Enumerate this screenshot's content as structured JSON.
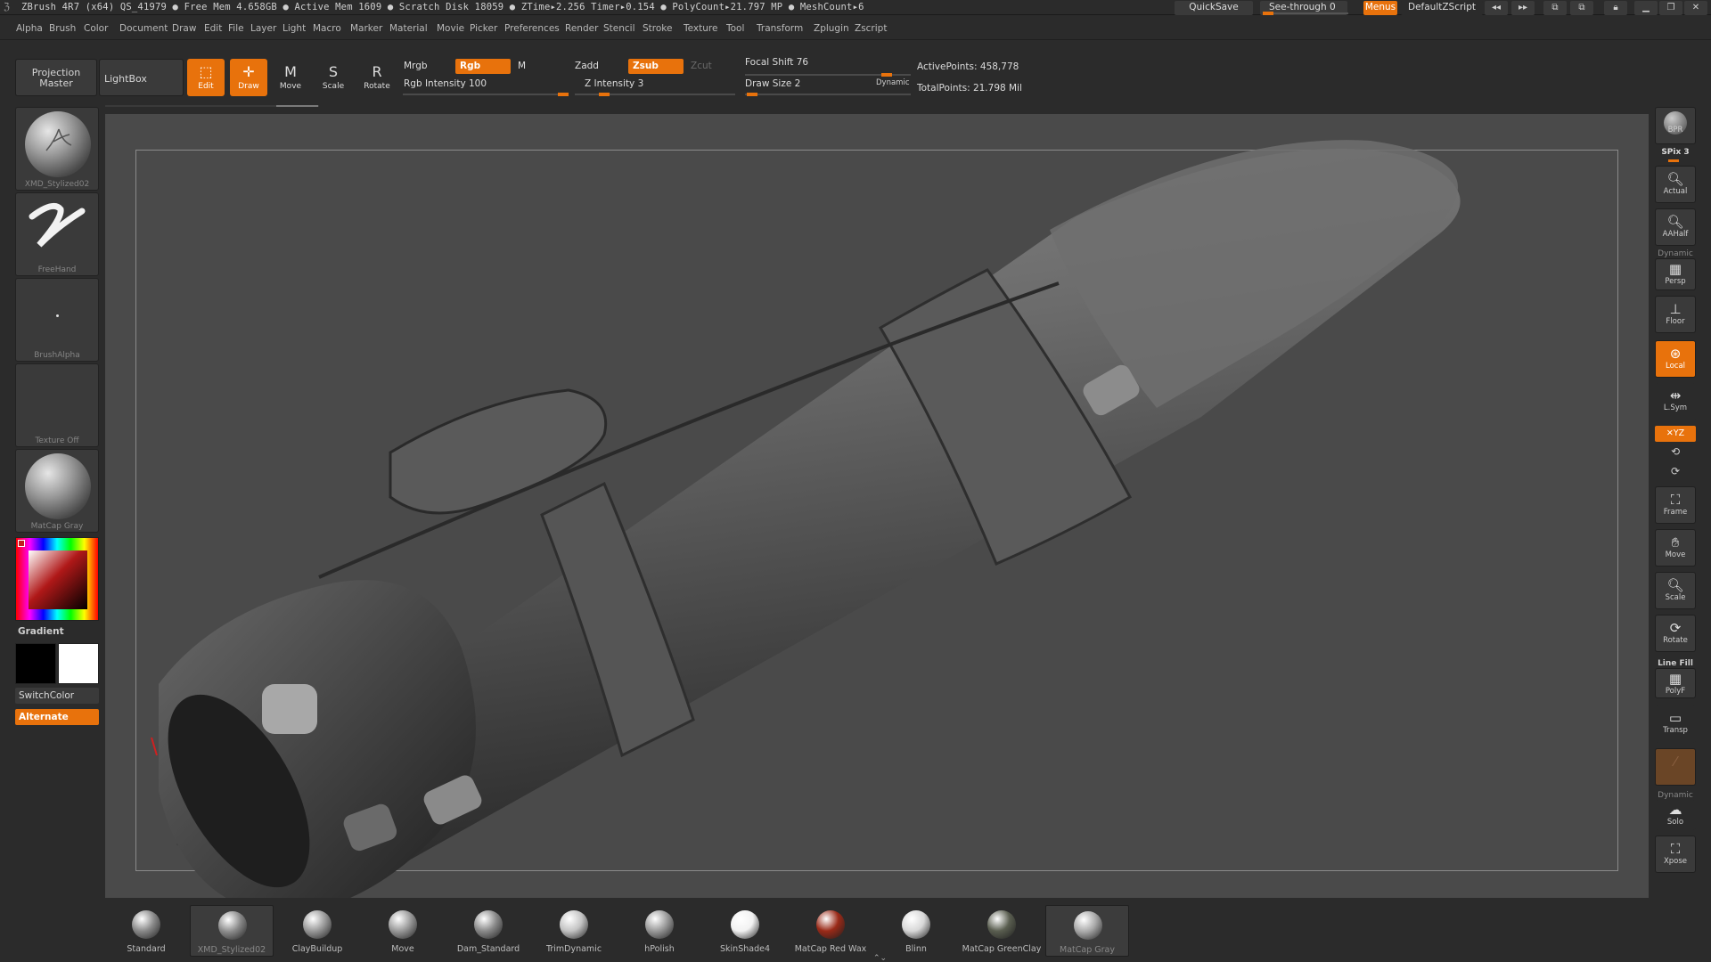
{
  "titlebar": {
    "status": "ZBrush 4R7 (x64)    QS_41979    ● Free Mem 4.658GB ● Active Mem 1609 ● Scratch Disk 18059 ● ZTime▸2.256 Timer▸0.154 ● PolyCount▸21.797 MP  ● MeshCount▸6",
    "quicksave": "QuickSave",
    "see_through": "See-through  0",
    "menus": "Menus",
    "script": "DefaultZScript"
  },
  "menubar": {
    "items": [
      "Alpha",
      "Brush",
      "Color",
      "Document",
      "Draw",
      "Edit",
      "File",
      "Layer",
      "Light",
      "Macro",
      "Marker",
      "Material",
      "Movie",
      "Picker",
      "Preferences",
      "Render",
      "Stencil",
      "Stroke",
      "Texture",
      "Tool",
      "Transform",
      "Zplugin",
      "Zscript"
    ]
  },
  "shelf": {
    "projection_master": "Projection Master",
    "lightbox": "LightBox",
    "edit": "Edit",
    "draw": "Draw",
    "move": "Move",
    "scale": "Scale",
    "rotate": "Rotate",
    "mrgb": "Mrgb",
    "rgb": "Rgb",
    "m": "M",
    "rgb_intensity": "Rgb  Intensity 100",
    "zadd": "Zadd",
    "zsub": "Zsub",
    "zcut": "Zcut",
    "z_intensity": "Z  Intensity 3",
    "focal_shift": "Focal  Shift 76",
    "draw_size": "Draw  Size 2",
    "dynamic": "Dynamic",
    "active_points": "ActivePoints: 458,778",
    "total_points": "TotalPoints: 21.798  Mil"
  },
  "lefttray": {
    "brush_name": "XMD_Stylized02",
    "stroke_name": "FreeHand",
    "alpha_name": "BrushAlpha",
    "texture_name": "Texture  Off",
    "material_name": "MatCap  Gray",
    "gradient": "Gradient",
    "switch_color": "SwitchColor",
    "alternate": "Alternate"
  },
  "righttray": {
    "bpr": "BPR",
    "spix": "SPix 3",
    "actual": "Actual",
    "aahalf": "AAHalf",
    "dynamic": "Dynamic",
    "persp": "Persp",
    "floor": "Floor",
    "local": "Local",
    "lsym": "L.Sym",
    "xyz": "✕YZ",
    "frame": "Frame",
    "move": "Move",
    "scale": "Scale",
    "rotate": "Rotate",
    "linefill": "Line Fill",
    "polyf": "PolyF",
    "transp": "Transp",
    "dynamic2": "Dynamic",
    "solo": "Solo",
    "xpose": "Xpose"
  },
  "materials": [
    {
      "label": "Standard",
      "color": "#8a8a8a"
    },
    {
      "label": "XMD_Stylized02",
      "color": "#8a8a8a",
      "selected": true
    },
    {
      "label": "ClayBuildup",
      "color": "#9a9a9a"
    },
    {
      "label": "Move",
      "color": "#9a9a9a"
    },
    {
      "label": "Dam_Standard",
      "color": "#8a8a8a"
    },
    {
      "label": "TrimDynamic",
      "color": "#c4c4c4"
    },
    {
      "label": "hPolish",
      "color": "#9a9a9a"
    },
    {
      "label": "SkinShade4",
      "color": "#f2f2f2"
    },
    {
      "label": "MatCap  Red  Wax",
      "color": "#9a2a18"
    },
    {
      "label": "Blinn",
      "color": "#d8d8d8"
    },
    {
      "label": "MatCap  GreenClay",
      "color": "#5a5e50"
    },
    {
      "label": "MatCap  Gray",
      "color": "#a8a8a8",
      "selected": true
    }
  ],
  "colors": {
    "accent": "#e8720c",
    "panel": "#2b2b2b",
    "viewport": "#4a4a4a"
  }
}
